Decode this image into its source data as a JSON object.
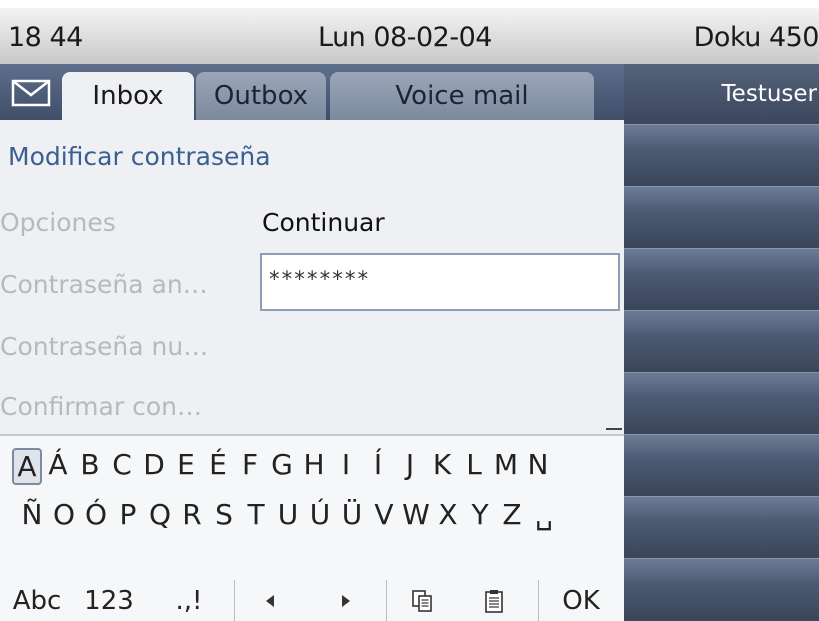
{
  "status": {
    "time": "18 44",
    "date": "Lun 08-02-04",
    "device": "Doku 450"
  },
  "tabs": [
    {
      "label": "Inbox",
      "active": true
    },
    {
      "label": "Outbox",
      "active": false
    },
    {
      "label": "Voice mail",
      "active": false
    }
  ],
  "side_panel": {
    "user": "Testuser"
  },
  "form": {
    "title": "Modificar contraseña",
    "rows": [
      {
        "label": "Opciones",
        "value": "Continuar"
      },
      {
        "label": "Contraseña an…",
        "value": "********"
      },
      {
        "label": "Contraseña nu…",
        "value": ""
      },
      {
        "label": "Confirmar con…",
        "value": ""
      }
    ]
  },
  "keyboard": {
    "row1": [
      "A",
      "Á",
      "B",
      "C",
      "D",
      "E",
      "É",
      "F",
      "G",
      "H",
      "I",
      "Í",
      "J",
      "K",
      "L",
      "M",
      "N"
    ],
    "row2": [
      "Ñ",
      "O",
      "Ó",
      "P",
      "Q",
      "R",
      "S",
      "T",
      "U",
      "Ú",
      "Ü",
      "V",
      "W",
      "X",
      "Y",
      "Z",
      "␣"
    ],
    "selected": "A"
  },
  "bottom_bar": {
    "abc": "Abc",
    "num": "123",
    "punct": ".,!",
    "left_icon": "arrow-left-icon",
    "right_icon": "arrow-right-icon",
    "copy_icon": "copy-icon",
    "paste_icon": "paste-icon",
    "ok": "OK"
  },
  "colors": {
    "accent_title": "#3b5f92",
    "panel_dark": "#3f4b62",
    "tab_active_bg": "#eef0f3"
  }
}
